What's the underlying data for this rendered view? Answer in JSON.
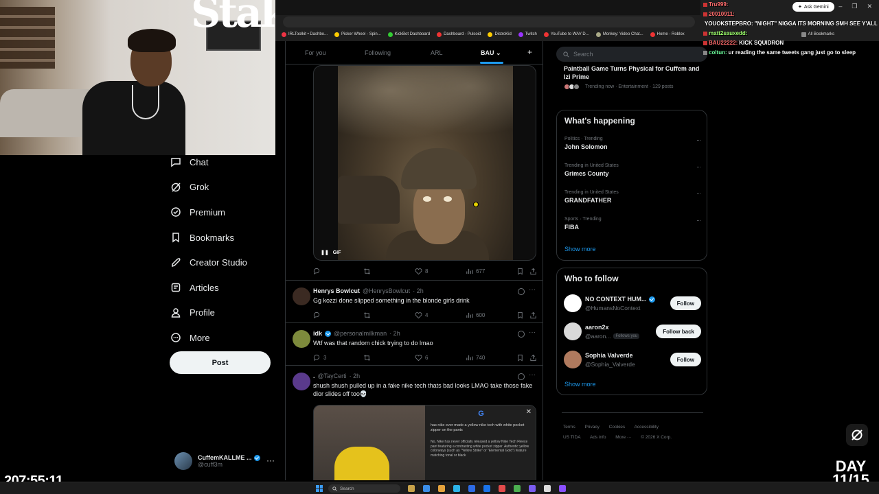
{
  "browser": {
    "ask_gemini": "Ask Gemini",
    "bookmarks": [
      "IRLToolkit • Dashbo...",
      "Picker Wheel - Spin...",
      "KickBot Dashboard",
      "Dashboard - Pulsoid",
      "DistroKid",
      "Twitch",
      "YouTube to WAV D...",
      "Monkey: Video Chat...",
      "Home - Roblox",
      "All Bookmarks"
    ]
  },
  "webcam": {
    "logo_text": "Stak"
  },
  "nav": {
    "items": [
      {
        "label": "Chat",
        "icon": "chat-icon"
      },
      {
        "label": "Grok",
        "icon": "grok-icon"
      },
      {
        "label": "Premium",
        "icon": "premium-icon"
      },
      {
        "label": "Bookmarks",
        "icon": "bookmark-icon"
      },
      {
        "label": "Creator Studio",
        "icon": "rocket-icon"
      },
      {
        "label": "Articles",
        "icon": "articles-icon"
      },
      {
        "label": "Profile",
        "icon": "profile-icon"
      },
      {
        "label": "More",
        "icon": "more-circle-icon"
      }
    ],
    "post_label": "Post"
  },
  "account": {
    "name": "CuffemKALLME ...",
    "handle": "@cuff3m",
    "more": "···"
  },
  "timeline": {
    "tabs": [
      "For you",
      "Following",
      "ARL",
      "BAU"
    ],
    "tab_add": "+",
    "tab_chevron": "⌄",
    "gif": {
      "badge": "GIF",
      "pause": "❚❚"
    },
    "gif_actions": {
      "retweets": "",
      "likes": "8",
      "views": "677"
    },
    "tweets": [
      {
        "name": "Henrys Bowlcut",
        "handle": "@HenrysBowlcut",
        "time": "· 2h",
        "text": "Gg kozzi done slipped something in the blonde girls drink",
        "replies": "",
        "likes": "4",
        "views": "600",
        "avatar_color": "#3b2a22",
        "verified": false
      },
      {
        "name": "idk",
        "handle": "@personalmilkman",
        "time": "· 2h",
        "text": "Wtf was that random chick trying to do lmao",
        "replies": "3",
        "likes": "6",
        "views": "740",
        "avatar_color": "#7d8a3c",
        "verified": true
      },
      {
        "name": ".",
        "handle": "@TayCerti",
        "time": "· 2h",
        "text": "shush shush pulled up in a fake nike tech thats bad looks LMAO take those fake dior slides off too💀",
        "replies": "",
        "likes": "",
        "views": "",
        "avatar_color": "#5a3a8c",
        "verified": false
      }
    ],
    "media2": {
      "google_logo": "G",
      "close": "✕",
      "question": "has nike ever made a yellow nike tech with white pocket zipper on the pants",
      "answer": "No, Nike has never officially released a yellow Nike Tech Fleece pant featuring a contrasting white pocket zipper. Authentic yellow colorways (such as \"Yellow Strike\" or \"Elemental Gold\") feature matching tonal or black"
    }
  },
  "right": {
    "search_placeholder": "Search",
    "top_news": {
      "title": "Paintball Game Turns Physical for Cuffem and Izi Prime",
      "meta": "Trending now · Entertainment · 129 posts"
    },
    "happening": {
      "title": "What's happening",
      "trends": [
        {
          "category": "Politics · Trending",
          "name": "John Solomon"
        },
        {
          "category": "Trending in United States",
          "name": "Grimes County"
        },
        {
          "category": "Trending in United States",
          "name": "GRANDFATHER"
        },
        {
          "category": "Sports · Trending",
          "name": "FIBA"
        }
      ],
      "show_more": "Show more"
    },
    "who_to_follow": {
      "title": "Who to follow",
      "accounts": [
        {
          "name": "NO CONTEXT HUM...",
          "handle": "@HumansNoContext",
          "button": "Follow",
          "follows_you": "",
          "verified": true,
          "avatar_color": "#ffffff"
        },
        {
          "name": "aaron2x",
          "handle": "@aaron...",
          "button": "Follow back",
          "follows_you": "Follows you",
          "verified": false,
          "avatar_color": "#d9d9d9"
        },
        {
          "name": "Sophia Valverde",
          "handle": "@Sophia_Valverde",
          "button": "Follow",
          "follows_you": "",
          "verified": false,
          "avatar_color": "#b07a5e"
        }
      ],
      "show_more": "Show more"
    },
    "footer": {
      "links": [
        "Terms",
        "Privacy",
        "Cookies",
        "Accessibility",
        "US TIDA",
        "Ads info",
        "More ···",
        "© 2026 X Corp."
      ]
    }
  },
  "chat": [
    {
      "user": "Tru999:",
      "msg": "",
      "color": "#ff6b6b"
    },
    {
      "user": "20010911:",
      "msg": "",
      "color": "#ff6b6b"
    },
    {
      "user": "YOUOKSTEPBRO:",
      "msg": "\"NIGHT\" NIGGA ITS MORNING SMH SEE Y'ALL 4PM EST",
      "color": "#ffffff"
    },
    {
      "user": "",
      "msg": "",
      "color": "#ffffff"
    },
    {
      "user": "matt2sauxedd:",
      "msg": "",
      "color": "#9cff6b"
    },
    {
      "user": "BAU22222:",
      "msg": "KICK SQUIDRON",
      "color": "#ff6b6b"
    },
    {
      "user": "coltun:",
      "msg": "ur reading the same tweets gang just go to sleep",
      "color": "#6bff9c"
    }
  ],
  "stream": {
    "timer": "207:55:11",
    "day_line1": "DAY",
    "day_line2": "11/15"
  },
  "taskbar": {
    "search": "Search"
  }
}
